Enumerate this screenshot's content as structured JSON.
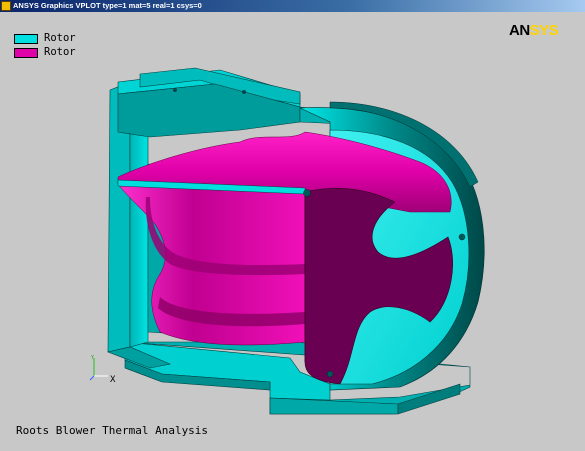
{
  "window": {
    "title": "ANSYS Graphics   VPLOT  type=1 mat=5 real=1 csys=0"
  },
  "legend": [
    {
      "label": "Rotor",
      "color": "#00e0e0"
    },
    {
      "label": "Rotor",
      "color": "#e000a8"
    }
  ],
  "logo": {
    "part1": "AN",
    "part2": "SYS"
  },
  "plot_title": "Roots Blower Thermal Analysis",
  "triad": {
    "x_label": "X"
  },
  "colors": {
    "housing": "#00c8c8",
    "housing_dark": "#008c8c",
    "rotor": "#e000a8",
    "rotor_dark": "#600050",
    "background": "#c8c8c8"
  },
  "icons": {
    "title_icon": "ansys-app-icon"
  }
}
